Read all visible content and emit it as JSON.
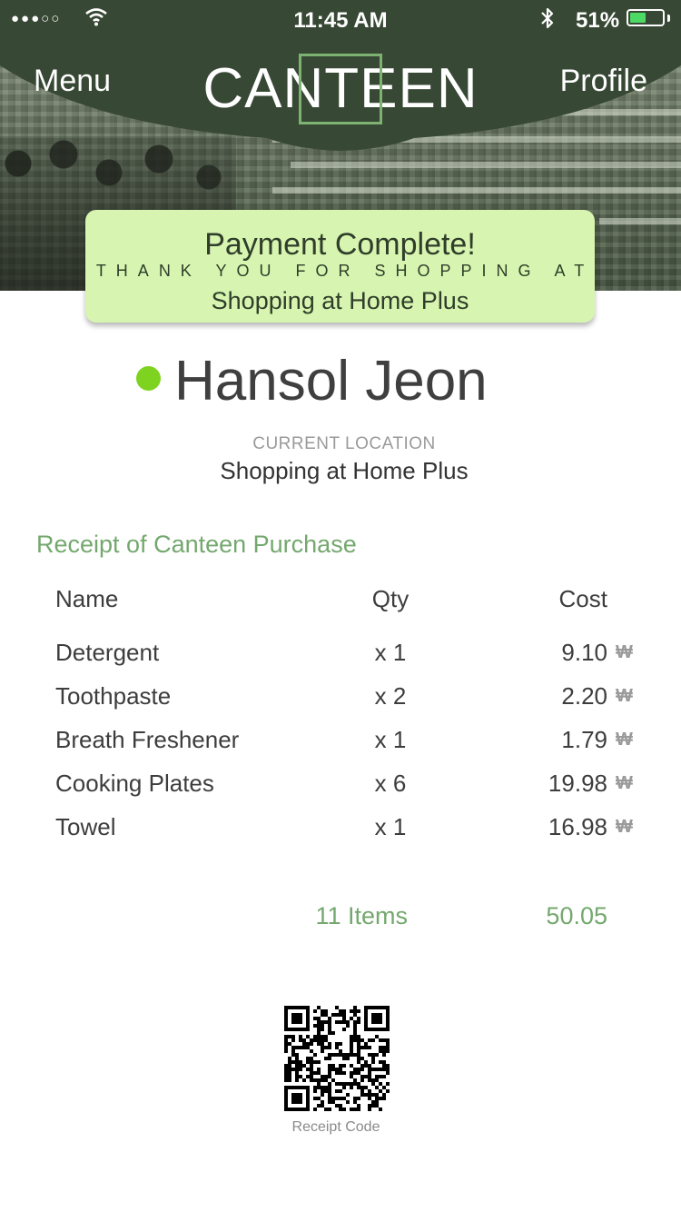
{
  "status_bar": {
    "signal": "●●●○○",
    "time": "11:45 AM",
    "battery_percent": "51%",
    "battery_level": 0.51,
    "battery_color": "#4cd964"
  },
  "header": {
    "menu_label": "Menu",
    "logo": "CANTEEN",
    "profile_label": "Profile",
    "header_color": "#374834",
    "logo_accent": "#7db272"
  },
  "banner": {
    "title": "Payment Complete!",
    "subtitle": "THANK YOU FOR SHOPPING AT",
    "store": "Shopping at Home Plus",
    "background": "#d7f5b0"
  },
  "user": {
    "name": "Hansol Jeon",
    "status_color": "#7ed321",
    "location_label": "CURRENT LOCATION",
    "location": "Shopping at Home Plus"
  },
  "receipt": {
    "title": "Receipt of Canteen Purchase",
    "headers": {
      "name": "Name",
      "qty": "Qty",
      "cost": "Cost"
    },
    "currency_symbol": "₩",
    "items": [
      {
        "name": "Detergent",
        "qty": "x 1",
        "cost": "9.10"
      },
      {
        "name": "Toothpaste",
        "qty": "x 2",
        "cost": "2.20"
      },
      {
        "name": "Breath Freshener",
        "qty": "x 1",
        "cost": "1.79"
      },
      {
        "name": "Cooking Plates",
        "qty": "x 6",
        "cost": "19.98"
      },
      {
        "name": "Towel",
        "qty": "x 1",
        "cost": "16.98"
      }
    ],
    "total_items": "11 Items",
    "total_cost": "50.05",
    "accent_color": "#74a86e"
  },
  "qr": {
    "label": "Receipt Code"
  }
}
